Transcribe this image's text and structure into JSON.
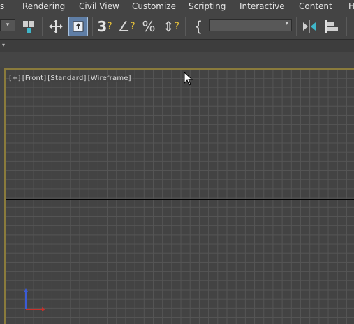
{
  "menu": {
    "items": [
      "s",
      "Rendering",
      "Civil View",
      "Customize",
      "Scripting",
      "Interactive",
      "Content",
      "H"
    ]
  },
  "toolbar": {
    "small_dropdown_arrow": "▾",
    "buttons": {
      "link_icon": "⚲",
      "move_icon": "✛",
      "select_icon": "⬆",
      "snap_3d": "3",
      "angle_snap": "∠",
      "percent_snap": "%",
      "spinner_snap": "⇕",
      "named_selection": "{",
      "mirror": "⫿",
      "align": "≡"
    },
    "named_selection_value": "",
    "dropdown_arrow": "▾"
  },
  "ribbon": {
    "arrow": "▾"
  },
  "viewport": {
    "label_plus": "[+]",
    "label_view": "[Front]",
    "label_shading_standard": "[Standard]",
    "label_shading_wireframe": "[Wireframe]",
    "border_color": "#8a7b3c"
  },
  "colors": {
    "active_button": "#5f7ea6",
    "axis_x": "#c8302a",
    "axis_z": "#3b5bd6"
  }
}
